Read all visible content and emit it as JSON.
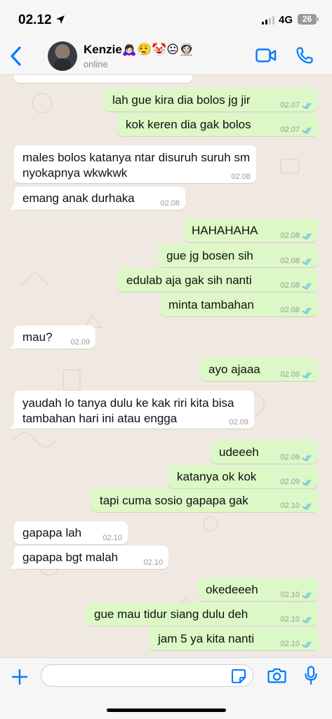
{
  "status": {
    "time": "02.12",
    "network": "4G",
    "battery": "26"
  },
  "header": {
    "contact_name": "Kenzie🙇🏻‍♀️😮‍💨🤡😐👩🏻‍🚀",
    "status": "online"
  },
  "messages": [
    {
      "dir": "out",
      "text": "lah gue kira dia bolos jg jir",
      "time": "02.07"
    },
    {
      "dir": "out",
      "text": "kok keren dia gak bolos",
      "time": "02.07"
    },
    {
      "dir": "in",
      "line1": "males bolos katanya ntar disuruh suruh sm",
      "line2": "nyokapnya wkwkwk",
      "time": "02.08"
    },
    {
      "dir": "in",
      "text": "emang anak durhaka",
      "time": "02.08"
    },
    {
      "dir": "out",
      "text": "HAHAHAHA",
      "time": "02.08"
    },
    {
      "dir": "out",
      "text": "gue jg bosen sih",
      "time": "02.08"
    },
    {
      "dir": "out",
      "text": "edulab aja gak sih nanti",
      "time": "02.08"
    },
    {
      "dir": "out",
      "text": "minta tambahan",
      "time": "02.08"
    },
    {
      "dir": "in",
      "text": "mau?",
      "time": "02.09"
    },
    {
      "dir": "out",
      "text": "ayo ajaaa",
      "time": "02.09"
    },
    {
      "dir": "in",
      "line1": "yaudah lo tanya dulu ke kak riri kita bisa",
      "line2": "tambahan hari ini atau engga",
      "time": "02.09"
    },
    {
      "dir": "out",
      "text": "udeeeh",
      "time": "02.09"
    },
    {
      "dir": "out",
      "text": "katanya ok kok",
      "time": "02.09"
    },
    {
      "dir": "out",
      "text": "tapi cuma sosio gapapa gak",
      "time": "02.10"
    },
    {
      "dir": "in",
      "text": "gapapa lah",
      "time": "02.10"
    },
    {
      "dir": "in",
      "text": "gapapa bgt malah",
      "time": "02.10"
    },
    {
      "dir": "out",
      "text": "okedeeeh",
      "time": "02.10"
    },
    {
      "dir": "out",
      "text": "gue mau tidur siang dulu deh",
      "time": "02.10"
    },
    {
      "dir": "out",
      "text": "jam 5 ya kita nanti",
      "time": "02.10"
    }
  ],
  "composer": {
    "placeholder": ""
  },
  "colors": {
    "accent": "#007aff",
    "outgoing_bubble": "#dcf8c6",
    "incoming_bubble": "#ffffff",
    "read_tick": "#4fb6ec"
  },
  "icons": [
    "location-arrow-icon",
    "back-chevron-icon",
    "video-call-icon",
    "phone-call-icon",
    "plus-icon",
    "sticker-icon",
    "camera-icon",
    "microphone-icon",
    "double-check-icon"
  ]
}
